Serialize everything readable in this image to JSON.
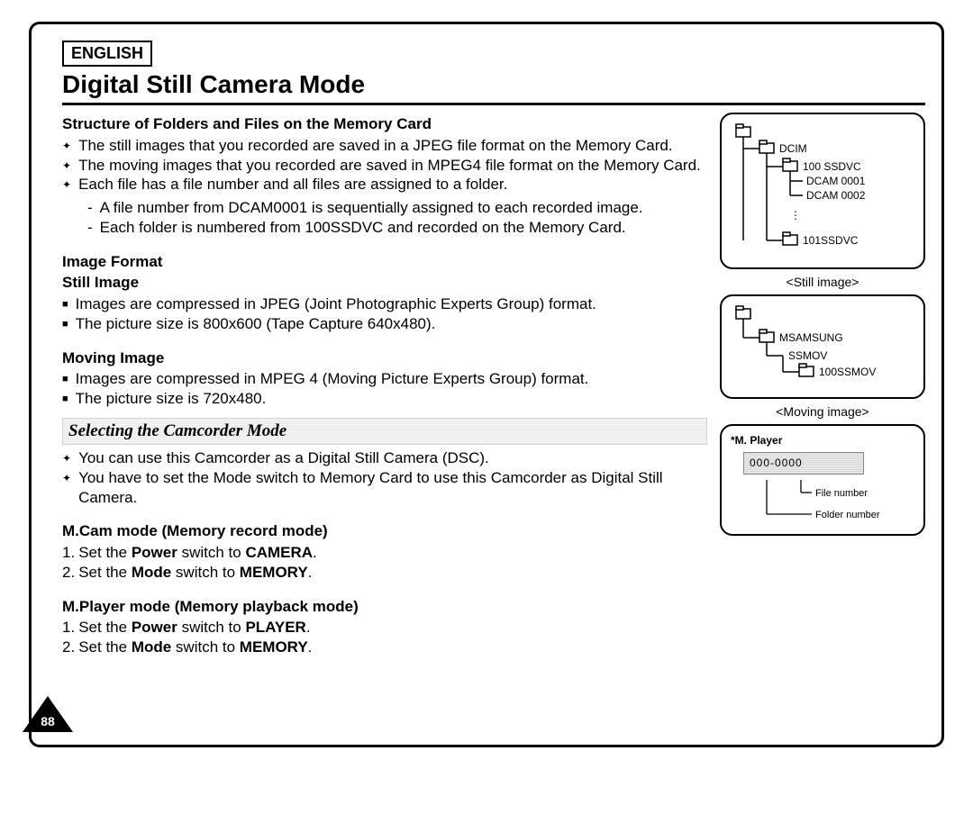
{
  "lang": "ENGLISH",
  "title": "Digital Still Camera Mode",
  "structure_heading": "Structure of Folders and Files on the Memory Card",
  "structure_bullets": [
    "The still images that you recorded are saved in a JPEG file format on the Memory Card.",
    "The moving images that you recorded are saved in MPEG4 file format on the Memory Card.",
    "Each file has a file number and all files are assigned to a folder."
  ],
  "structure_sub": [
    "A file number from DCAM0001 is sequentially assigned to each recorded image.",
    "Each folder is numbered from 100SSDVC and recorded on the Memory Card."
  ],
  "image_format_heading": "Image Format",
  "still_heading": "Still Image",
  "still_bullets": [
    "Images are compressed in JPEG (Joint Photographic Experts Group) format.",
    "The picture size is 800x600 (Tape Capture 640x480)."
  ],
  "moving_heading": "Moving Image",
  "moving_bullets": [
    "Images are compressed in MPEG 4 (Moving Picture Experts Group) format.",
    "The picture size is 720x480."
  ],
  "banner": "Selecting the Camcorder Mode",
  "mode_bullets": [
    "You can use this Camcorder as a Digital Still Camera (DSC).",
    "You have to set the Mode switch to Memory Card to use this Camcorder as Digital Still Camera."
  ],
  "mcam_heading": "M.Cam mode (Memory record mode)",
  "mcam_steps_html": [
    "Set the <b>Power</b> switch to <b>CAMERA</b>.",
    "Set the <b>Mode</b> switch to <b>MEMORY</b>."
  ],
  "mplayer_heading": "M.Player mode (Memory playback mode)",
  "mplayer_steps_html": [
    "Set the <b>Power</b> switch to <b>PLAYER</b>.",
    "Set the <b>Mode</b> switch to <b>MEMORY</b>."
  ],
  "tree_still": {
    "dcim": "DCIM",
    "f1": "100 SSDVC",
    "file1": "DCAM 0001",
    "file2": "DCAM 0002",
    "f2": "101SSDVC"
  },
  "caption_still": "<Still image>",
  "tree_mov": {
    "root": "MSAMSUNG",
    "sub": "SSMOV",
    "leaf": "100SSMOV"
  },
  "caption_mov": "<Moving image>",
  "panel3": {
    "title": "*M. Player",
    "display": "000-0000",
    "file_label": "File number",
    "folder_label": "Folder number"
  },
  "page_number": "88"
}
